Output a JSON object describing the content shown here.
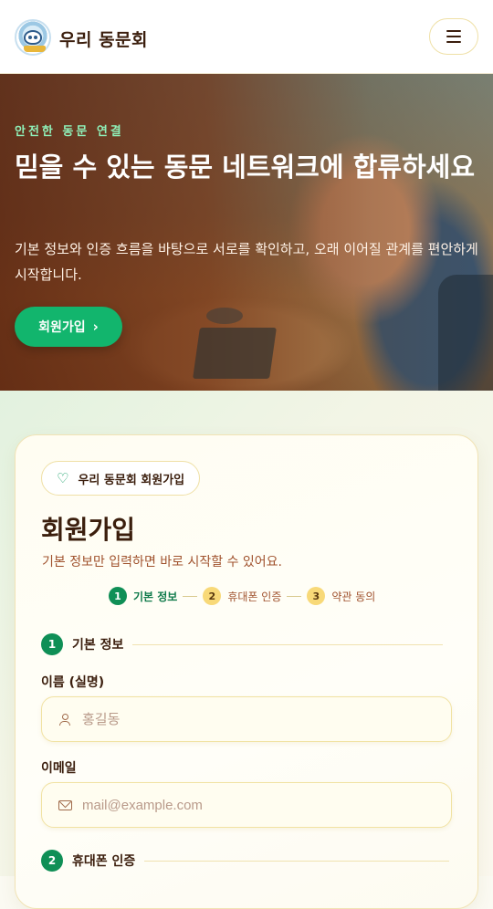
{
  "header": {
    "brand": "우리 동문회",
    "menu_icon": "hamburger-menu-icon",
    "logo_icon": "alumni-logo"
  },
  "hero": {
    "eyebrow": "안전한 동문 연결",
    "title": "믿을 수 있는 동문 네트워크에 합류하세요",
    "description": "기본 정보와 인증 흐름을 바탕으로 서로를 확인하고, 오래 이어질 관계를 편안하게 시작합니다.",
    "cta_label": "회원가입",
    "cta_icon": "chevron-right-icon"
  },
  "signup": {
    "badge": "우리 동문회 회원가입",
    "badge_icon": "heart-handshake-icon",
    "title": "회원가입",
    "subtitle": "기본 정보만 입력하면 바로 시작할 수 있어요.",
    "steps": [
      {
        "num": "1",
        "label": "기본 정보",
        "state": "active"
      },
      {
        "num": "2",
        "label": "휴대폰 인증",
        "state": "pending"
      },
      {
        "num": "3",
        "label": "약관 동의",
        "state": "pending"
      }
    ],
    "section1": {
      "num": "1",
      "title": "기본 정보"
    },
    "name_field": {
      "label": "이름 (실명)",
      "placeholder": "홍길동",
      "value": "",
      "icon": "user-icon"
    },
    "email_field": {
      "label": "이메일",
      "placeholder": "mail@example.com",
      "value": "",
      "icon": "mail-icon"
    },
    "section2": {
      "num": "2",
      "title": "휴대폰 인증"
    }
  },
  "colors": {
    "accent_green": "#0f8f56",
    "cta_green": "#12b56d",
    "brown_text": "#3b1e0d",
    "pending_yellow": "#f8d978"
  }
}
